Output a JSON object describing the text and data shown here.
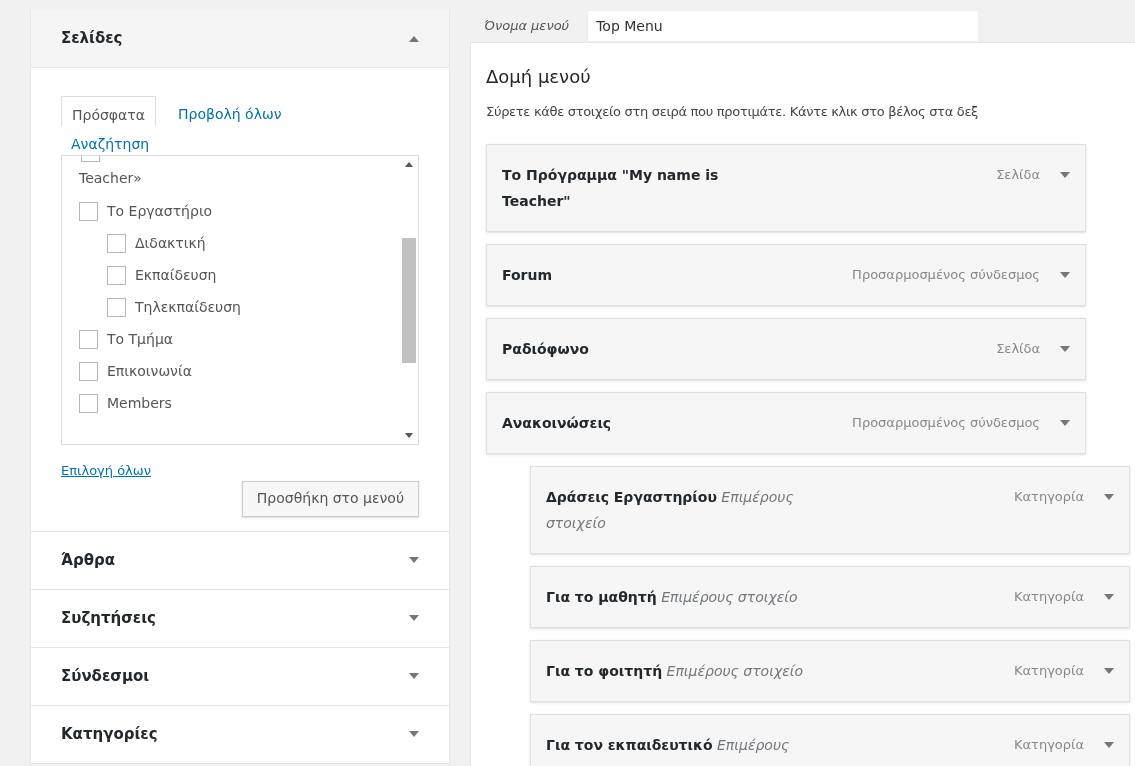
{
  "sidebar": {
    "sections": [
      {
        "title": "Σελίδες",
        "expanded": true
      },
      {
        "title": "Άρθρα",
        "expanded": false
      },
      {
        "title": "Συζητήσεις",
        "expanded": false
      },
      {
        "title": "Σύνδεσμοι",
        "expanded": false
      },
      {
        "title": "Κατηγορίες",
        "expanded": false
      }
    ],
    "tabs": [
      {
        "label": "Πρόσφατα",
        "selected": true
      },
      {
        "label": "Προβολή όλων",
        "selected": false
      },
      {
        "label": "Αναζήτηση",
        "selected": false
      }
    ],
    "pages": [
      {
        "label": "Teacher»",
        "kind": "continuation",
        "checked": false
      },
      {
        "label": "Το Εργαστήριο",
        "checked": false,
        "kind": "item",
        "children": [
          {
            "label": "Διδακτική",
            "checked": false,
            "kind": "item"
          },
          {
            "label": "Εκπαίδευση",
            "checked": false,
            "kind": "item"
          },
          {
            "label": "Τηλεκπαίδευση",
            "checked": false,
            "kind": "item"
          }
        ]
      },
      {
        "label": "Το Τμήμα",
        "checked": false,
        "kind": "item"
      },
      {
        "label": "Επικοινωνία",
        "checked": false,
        "kind": "item"
      },
      {
        "label": "Members",
        "checked": false,
        "kind": "item"
      }
    ],
    "select_all": "Επιλογή όλων",
    "add_button": "Προσθήκη στο μενού"
  },
  "menu": {
    "name_label": "Όνομα μενού",
    "name_value": "Top Menu",
    "heading": "Δομή μενού",
    "instructions": "Σύρετε κάθε στοιχείο στη σειρά που προτιμάτε. Κάντε κλικ στο βέλος στα δεξ",
    "items": [
      {
        "title": "Το Πρόγραμμα \"My name is Teacher\"",
        "type": "Σελίδα"
      },
      {
        "title": "Forum",
        "type": "Προσαρμοσμένος σύνδεσμος"
      },
      {
        "title": "Ραδιόφωνο",
        "type": "Σελίδα"
      },
      {
        "title": "Ανακοινώσεις",
        "type": "Προσαρμοσμένος σύνδεσμος",
        "children": [
          {
            "title": "Δράσεις Εργαστηρίου",
            "sub": "Επιμέρους στοιχείο",
            "type": "Κατηγορία"
          },
          {
            "title": "Για το μαθητή",
            "sub": "Επιμέρους στοιχείο",
            "type": "Κατηγορία"
          },
          {
            "title": "Για το φοιτητή",
            "sub": "Επιμέρους στοιχείο",
            "type": "Κατηγορία"
          },
          {
            "title": "Για τον εκπαιδευτικό",
            "sub": "Επιμέρους",
            "type": "Κατηγορία"
          }
        ]
      }
    ]
  }
}
